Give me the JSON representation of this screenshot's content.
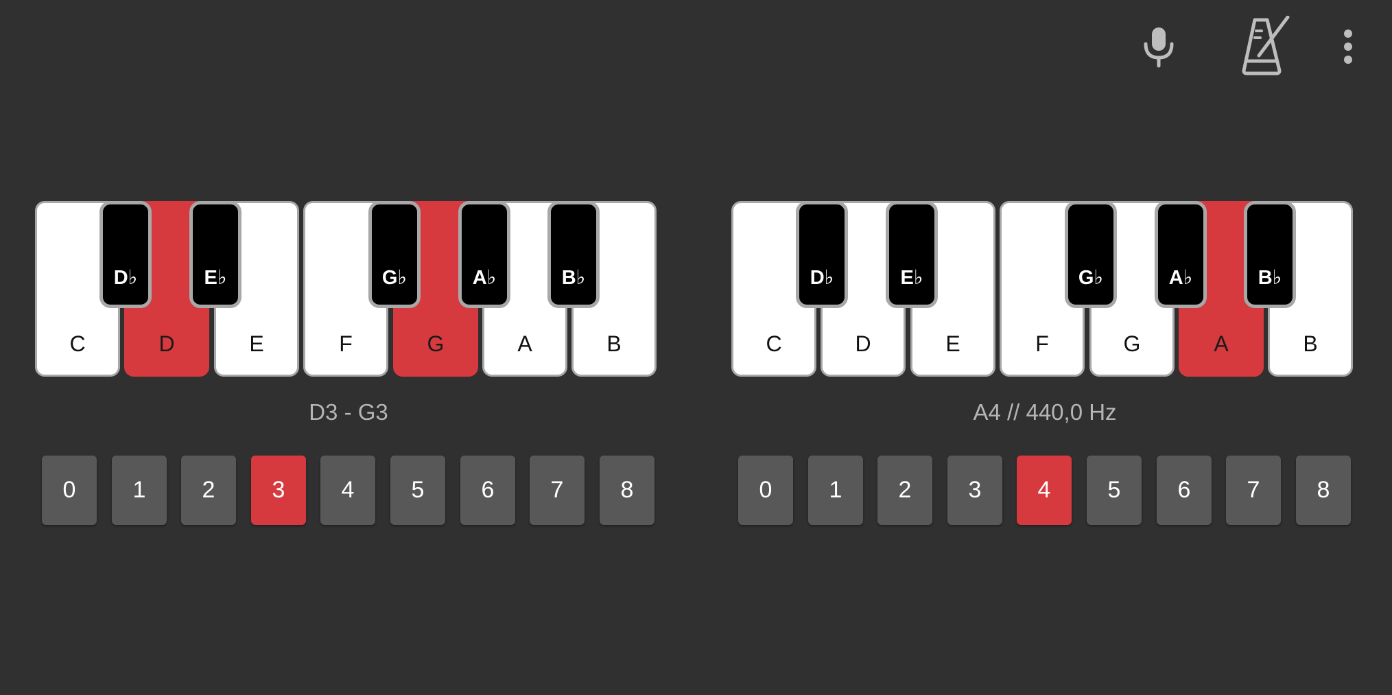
{
  "colors": {
    "background": "#303030",
    "accent": "#d63a3f",
    "octave_button": "#585858",
    "key_border": "#a8a8a8",
    "secondary_text": "#b5b5b5"
  },
  "toolbar": {
    "mic_icon": "microphone-icon",
    "metronome_icon": "metronome-icon",
    "menu_icon": "more-vert-icon"
  },
  "left_piano": {
    "white_keys": [
      {
        "label": "C",
        "active": false
      },
      {
        "label": "D",
        "active": true
      },
      {
        "label": "E",
        "active": false
      },
      {
        "label": "F",
        "active": false
      },
      {
        "label": "G",
        "active": true
      },
      {
        "label": "A",
        "active": false
      },
      {
        "label": "B",
        "active": false
      }
    ],
    "black_keys": [
      {
        "label": "D♭"
      },
      {
        "label": "E♭"
      },
      {
        "label": "G♭"
      },
      {
        "label": "A♭"
      },
      {
        "label": "B♭"
      }
    ],
    "range_text": "D3 - G3",
    "octaves": [
      "0",
      "1",
      "2",
      "3",
      "4",
      "5",
      "6",
      "7",
      "8"
    ],
    "selected_octave": "3"
  },
  "right_piano": {
    "white_keys": [
      {
        "label": "C",
        "active": false
      },
      {
        "label": "D",
        "active": false
      },
      {
        "label": "E",
        "active": false
      },
      {
        "label": "F",
        "active": false
      },
      {
        "label": "G",
        "active": false
      },
      {
        "label": "A",
        "active": true
      },
      {
        "label": "B",
        "active": false
      }
    ],
    "black_keys": [
      {
        "label": "D♭"
      },
      {
        "label": "E♭"
      },
      {
        "label": "G♭"
      },
      {
        "label": "A♭"
      },
      {
        "label": "B♭"
      }
    ],
    "range_text": "A4 // 440,0 Hz",
    "octaves": [
      "0",
      "1",
      "2",
      "3",
      "4",
      "5",
      "6",
      "7",
      "8"
    ],
    "selected_octave": "4"
  }
}
